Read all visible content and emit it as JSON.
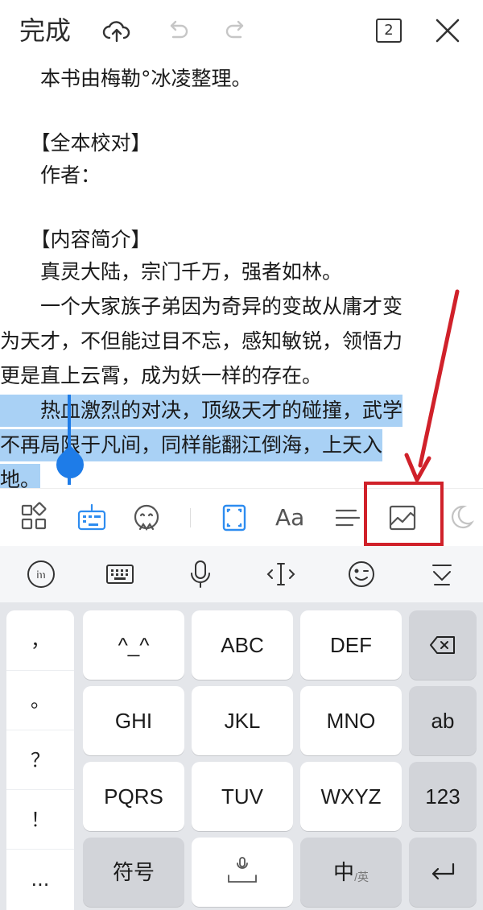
{
  "topbar": {
    "done_label": "完成",
    "page_count": "2",
    "icons": [
      "cloud-upload-icon",
      "undo-icon",
      "redo-icon",
      "close-icon"
    ]
  },
  "document": {
    "lines": [
      "　　本书由梅勒°冰凌整理。",
      "",
      "　　【全本校对】",
      "　　作者：",
      "",
      "　　【内容简介】",
      "　　真灵大陆，宗门千万，强者如林。",
      "　　一个大家族子弟因为奇异的变故从庸才变",
      "为天才，不但能过目不忘，感知敏锐，领悟力",
      "更是直上云霄，成为妖一样的存在。"
    ],
    "selected_lines": [
      "　　热血激烈的对决，顶级天才的碰撞，武学",
      "不再局限于凡间，同样能翻江倒海，上天入",
      "地。"
    ]
  },
  "toolbar": {
    "font_label": "Aa",
    "icons": [
      "apps-icon",
      "keyboard-icon",
      "sticker-icon",
      "fullscreen-icon",
      "font-icon",
      "align-icon",
      "insert-image-icon"
    ]
  },
  "ime_bar": {
    "icons": [
      "ime-logo-icon",
      "keyboard-switch-icon",
      "microphone-icon",
      "cursor-move-icon",
      "emoji-icon",
      "collapse-keyboard-icon"
    ]
  },
  "keyboard": {
    "punctuation": [
      "，",
      "。",
      "？",
      "！",
      "..."
    ],
    "row1": [
      "^_^",
      "ABC",
      "DEF"
    ],
    "row2": [
      "GHI",
      "JKL",
      "MNO"
    ],
    "row3": [
      "PQRS",
      "TUV",
      "WXYZ"
    ],
    "right": [
      "ab",
      "123"
    ],
    "symbols_label": "符号",
    "lang_label_main": "中",
    "lang_label_sub": "/英"
  },
  "colors": {
    "selection": "#a9d1f5",
    "handle": "#1e7ce8",
    "annotation": "#d0212a",
    "active_icon": "#2d8cf0"
  }
}
